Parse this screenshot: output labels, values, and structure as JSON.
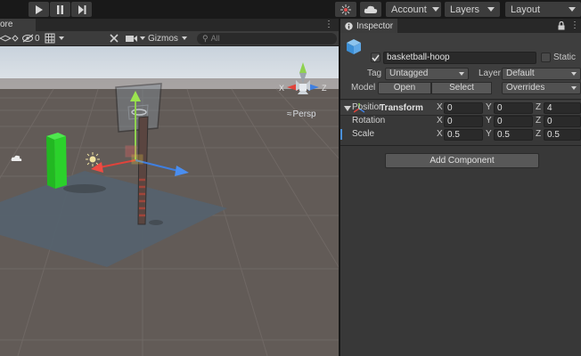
{
  "toolbar": {
    "account_label": "Account",
    "layers_label": "Layers",
    "layout_label": "Layout"
  },
  "scene": {
    "tab_label": "ore",
    "hidden_count": "0",
    "gizmos_label": "Gizmos",
    "search_placeholder": "All",
    "persp_label": "Persp",
    "axis_x": "X",
    "axis_z": "Z"
  },
  "inspector": {
    "tab_label": "Inspector",
    "object_name": "basketball-hoop",
    "static_label": "Static",
    "tag_label": "Tag",
    "tag_value": "Untagged",
    "layer_label": "Layer",
    "layer_value": "Default",
    "model_label": "Model",
    "open_label": "Open",
    "select_label": "Select",
    "overrides_label": "Overrides",
    "add_component_label": "Add Component"
  },
  "transform": {
    "title": "Transform",
    "rows": [
      {
        "label": "Position",
        "x": "0",
        "y": "0",
        "z": "4"
      },
      {
        "label": "Rotation",
        "x": "0",
        "y": "0",
        "z": "0"
      },
      {
        "label": "Scale",
        "x": "0.5",
        "y": "0.5",
        "z": "0.5"
      }
    ],
    "axis_x": "X",
    "axis_y": "Y",
    "axis_z": "Z"
  },
  "colors": {
    "accent_blue": "#4a90d9",
    "axis_red": "#e0433b",
    "axis_green": "#8fd14f",
    "axis_blue": "#3f7fe0",
    "cube_green": "#2ecc2e"
  }
}
